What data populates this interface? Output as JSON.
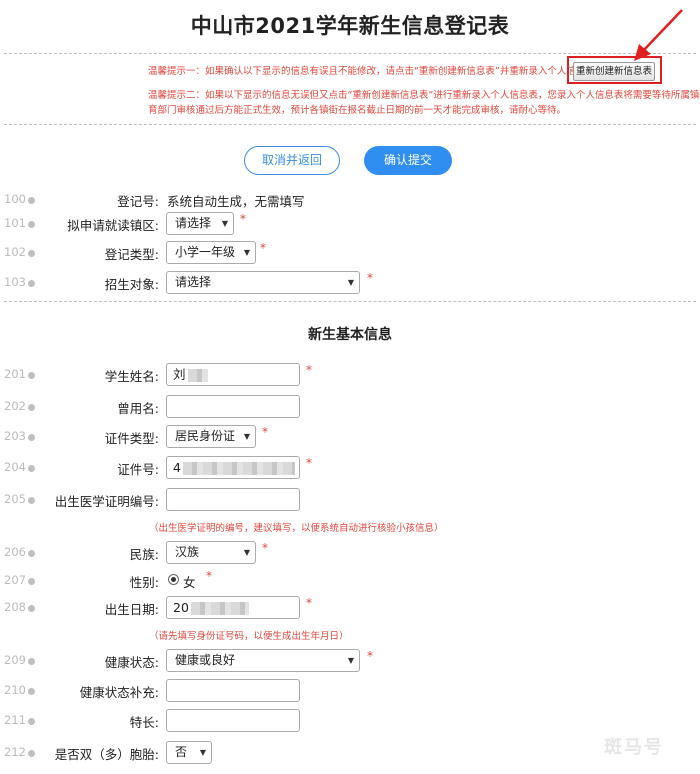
{
  "title": "中山市2021学年新生信息登记表",
  "notices": {
    "tip1": "温馨提示一：如果确认以下显示的信息有误且不能修改，请点击“重新创建新信息表”并重新录入个人信息表。",
    "tip2_line1": "温馨提示二：如果以下显示的信息无误但又点击“重新创建新信息表”进行重新录入个人信息表，您录入个人信息表将需要等待所属镇街教",
    "tip2_line2": "育部门审核通过后方能正式生效，预计各镇街在报名截止日期的前一天才能完成审核，请耐心等待。",
    "recreate_button": "重新创建新信息表"
  },
  "actions": {
    "cancel": "取消并返回",
    "submit": "确认提交"
  },
  "fields_basic": [
    {
      "num": "100",
      "label": "登记号:",
      "value": "系统自动生成，无需填写"
    },
    {
      "num": "101",
      "label": "拟申请就读镇区:",
      "value": "请选择",
      "required": "*"
    },
    {
      "num": "102",
      "label": "登记类型:",
      "value": "小学一年级",
      "required": "*"
    },
    {
      "num": "103",
      "label": "招生对象:",
      "value": "请选择",
      "required": "*"
    }
  ],
  "section_title": "新生基本信息",
  "fields_student": [
    {
      "num": "201",
      "label": "学生姓名:",
      "value": "刘",
      "required": "*"
    },
    {
      "num": "202",
      "label": "曾用名:",
      "value": ""
    },
    {
      "num": "203",
      "label": "证件类型:",
      "value": "居民身份证",
      "required": "*"
    },
    {
      "num": "204",
      "label": "证件号:",
      "value": "4",
      "required": "*"
    },
    {
      "num": "205",
      "label": "出生医学证明编号:",
      "value": ""
    },
    {
      "num": "206",
      "label": "民族:",
      "value": "汉族",
      "required": "*"
    },
    {
      "num": "207",
      "label": "性别:",
      "value": "女",
      "required": "*"
    },
    {
      "num": "208",
      "label": "出生日期:",
      "value": "20",
      "required": "*"
    },
    {
      "num": "209",
      "label": "健康状态:",
      "value": "健康或良好",
      "required": "*"
    },
    {
      "num": "210",
      "label": "健康状态补充:",
      "value": ""
    },
    {
      "num": "211",
      "label": "特长:",
      "value": ""
    },
    {
      "num": "212",
      "label": "是否双（多）胞胎:",
      "value": "否"
    }
  ],
  "hints": {
    "birth_cert": "（出生医学证明的编号，建议填写，以便系统自动进行核验小孩信息）",
    "birth_date": "（请先填写身份证号码，以便生成出生年月日）"
  },
  "icons": {
    "caret": "caret-down-icon",
    "arrow": "red-arrow-icon"
  },
  "colors": {
    "accent": "#2f8ef0",
    "warning": "#e2463e",
    "highlight": "#e02020"
  },
  "watermark": "斑马号"
}
